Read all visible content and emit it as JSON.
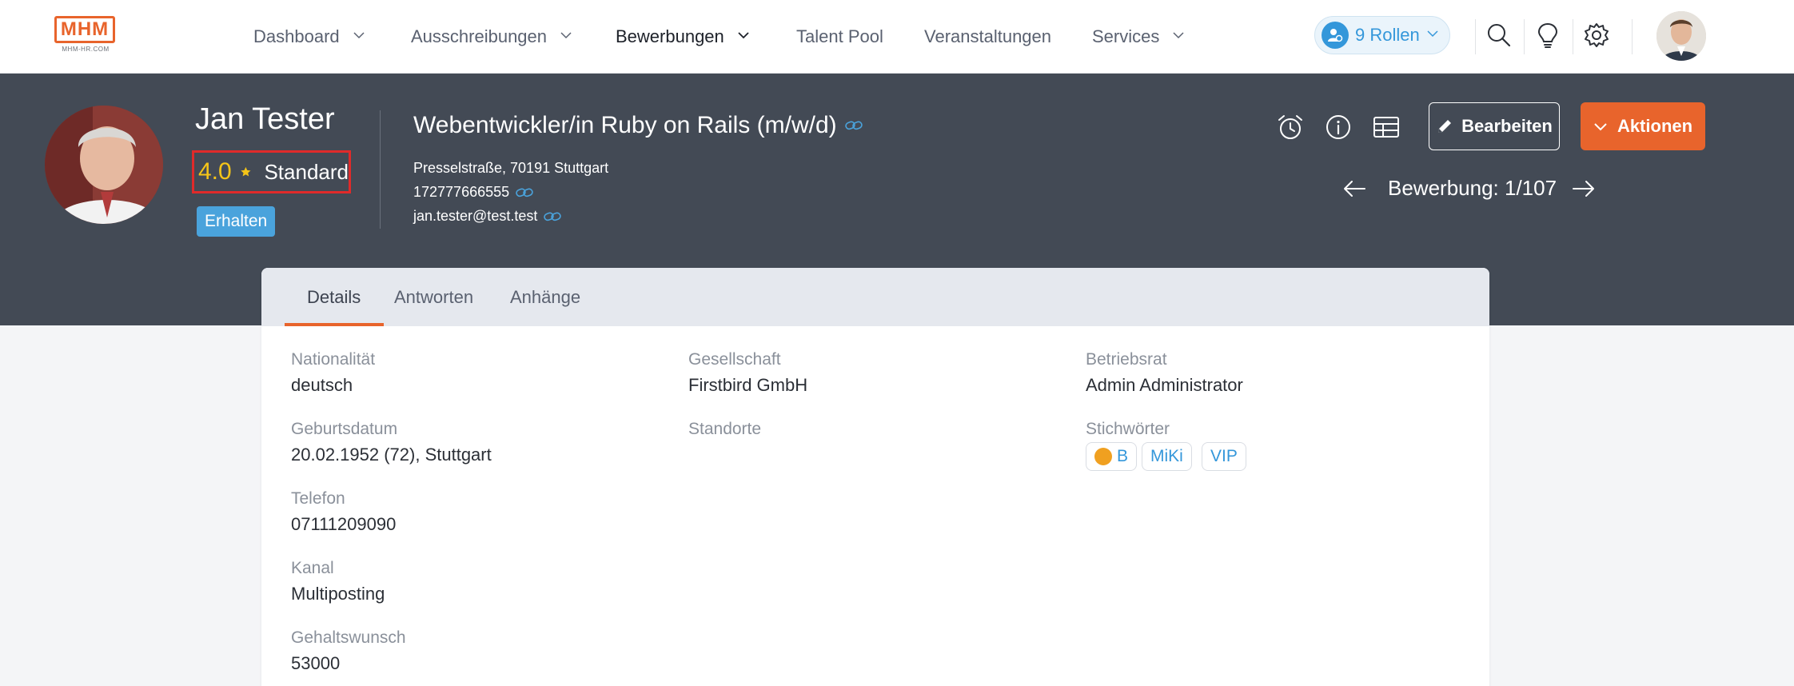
{
  "brand": {
    "logo_text": "MHM",
    "logo_subtext": "MHM-HR.COM",
    "accent": "#e8642c"
  },
  "nav": {
    "items": [
      {
        "label": "Dashboard",
        "dropdown": true
      },
      {
        "label": "Ausschreibungen",
        "dropdown": true
      },
      {
        "label": "Bewerbungen",
        "dropdown": true,
        "active": true
      },
      {
        "label": "Talent Pool",
        "dropdown": false
      },
      {
        "label": "Veranstaltungen",
        "dropdown": false
      },
      {
        "label": "Services",
        "dropdown": true
      }
    ],
    "roles_label": "9 Rollen",
    "icons": [
      "search-icon",
      "lightbulb-icon",
      "gear-icon"
    ]
  },
  "candidate": {
    "name": "Jan Tester",
    "rating": "4.0",
    "rating_label": "Standard",
    "status": "Erhalten",
    "job_title": "Webentwickler/in Ruby on Rails (m/w/d)",
    "address": "Presselstraße, 70191 Stuttgart",
    "phone": "172777666555",
    "email": "jan.tester@test.test"
  },
  "header_actions": {
    "icons": [
      "alarm-clock-icon",
      "info-icon",
      "table-icon"
    ],
    "edit_label": "Bearbeiten",
    "actions_label": "Aktionen",
    "counter": "Bewerbung: 1/107"
  },
  "tabs": [
    {
      "label": "Details",
      "active": true
    },
    {
      "label": "Antworten",
      "active": false
    },
    {
      "label": "Anhänge",
      "active": false
    }
  ],
  "details": {
    "col1": [
      {
        "label": "Nationalität",
        "value": "deutsch"
      },
      {
        "label": "Geburtsdatum",
        "value": "20.02.1952 (72), Stuttgart"
      },
      {
        "label": "Telefon",
        "value": "07111209090"
      },
      {
        "label": "Kanal",
        "value": "Multiposting"
      },
      {
        "label": "Gehaltswunsch",
        "value": "53000"
      }
    ],
    "col2": [
      {
        "label": "Gesellschaft",
        "value": "Firstbird GmbH"
      },
      {
        "label": "Standorte",
        "value": ""
      }
    ],
    "col3": [
      {
        "label": "Betriebsrat",
        "value": "Admin Administrator"
      },
      {
        "label": "Stichwörter",
        "value": ""
      }
    ],
    "tags": [
      "B",
      "MiKi",
      "VIP"
    ]
  }
}
